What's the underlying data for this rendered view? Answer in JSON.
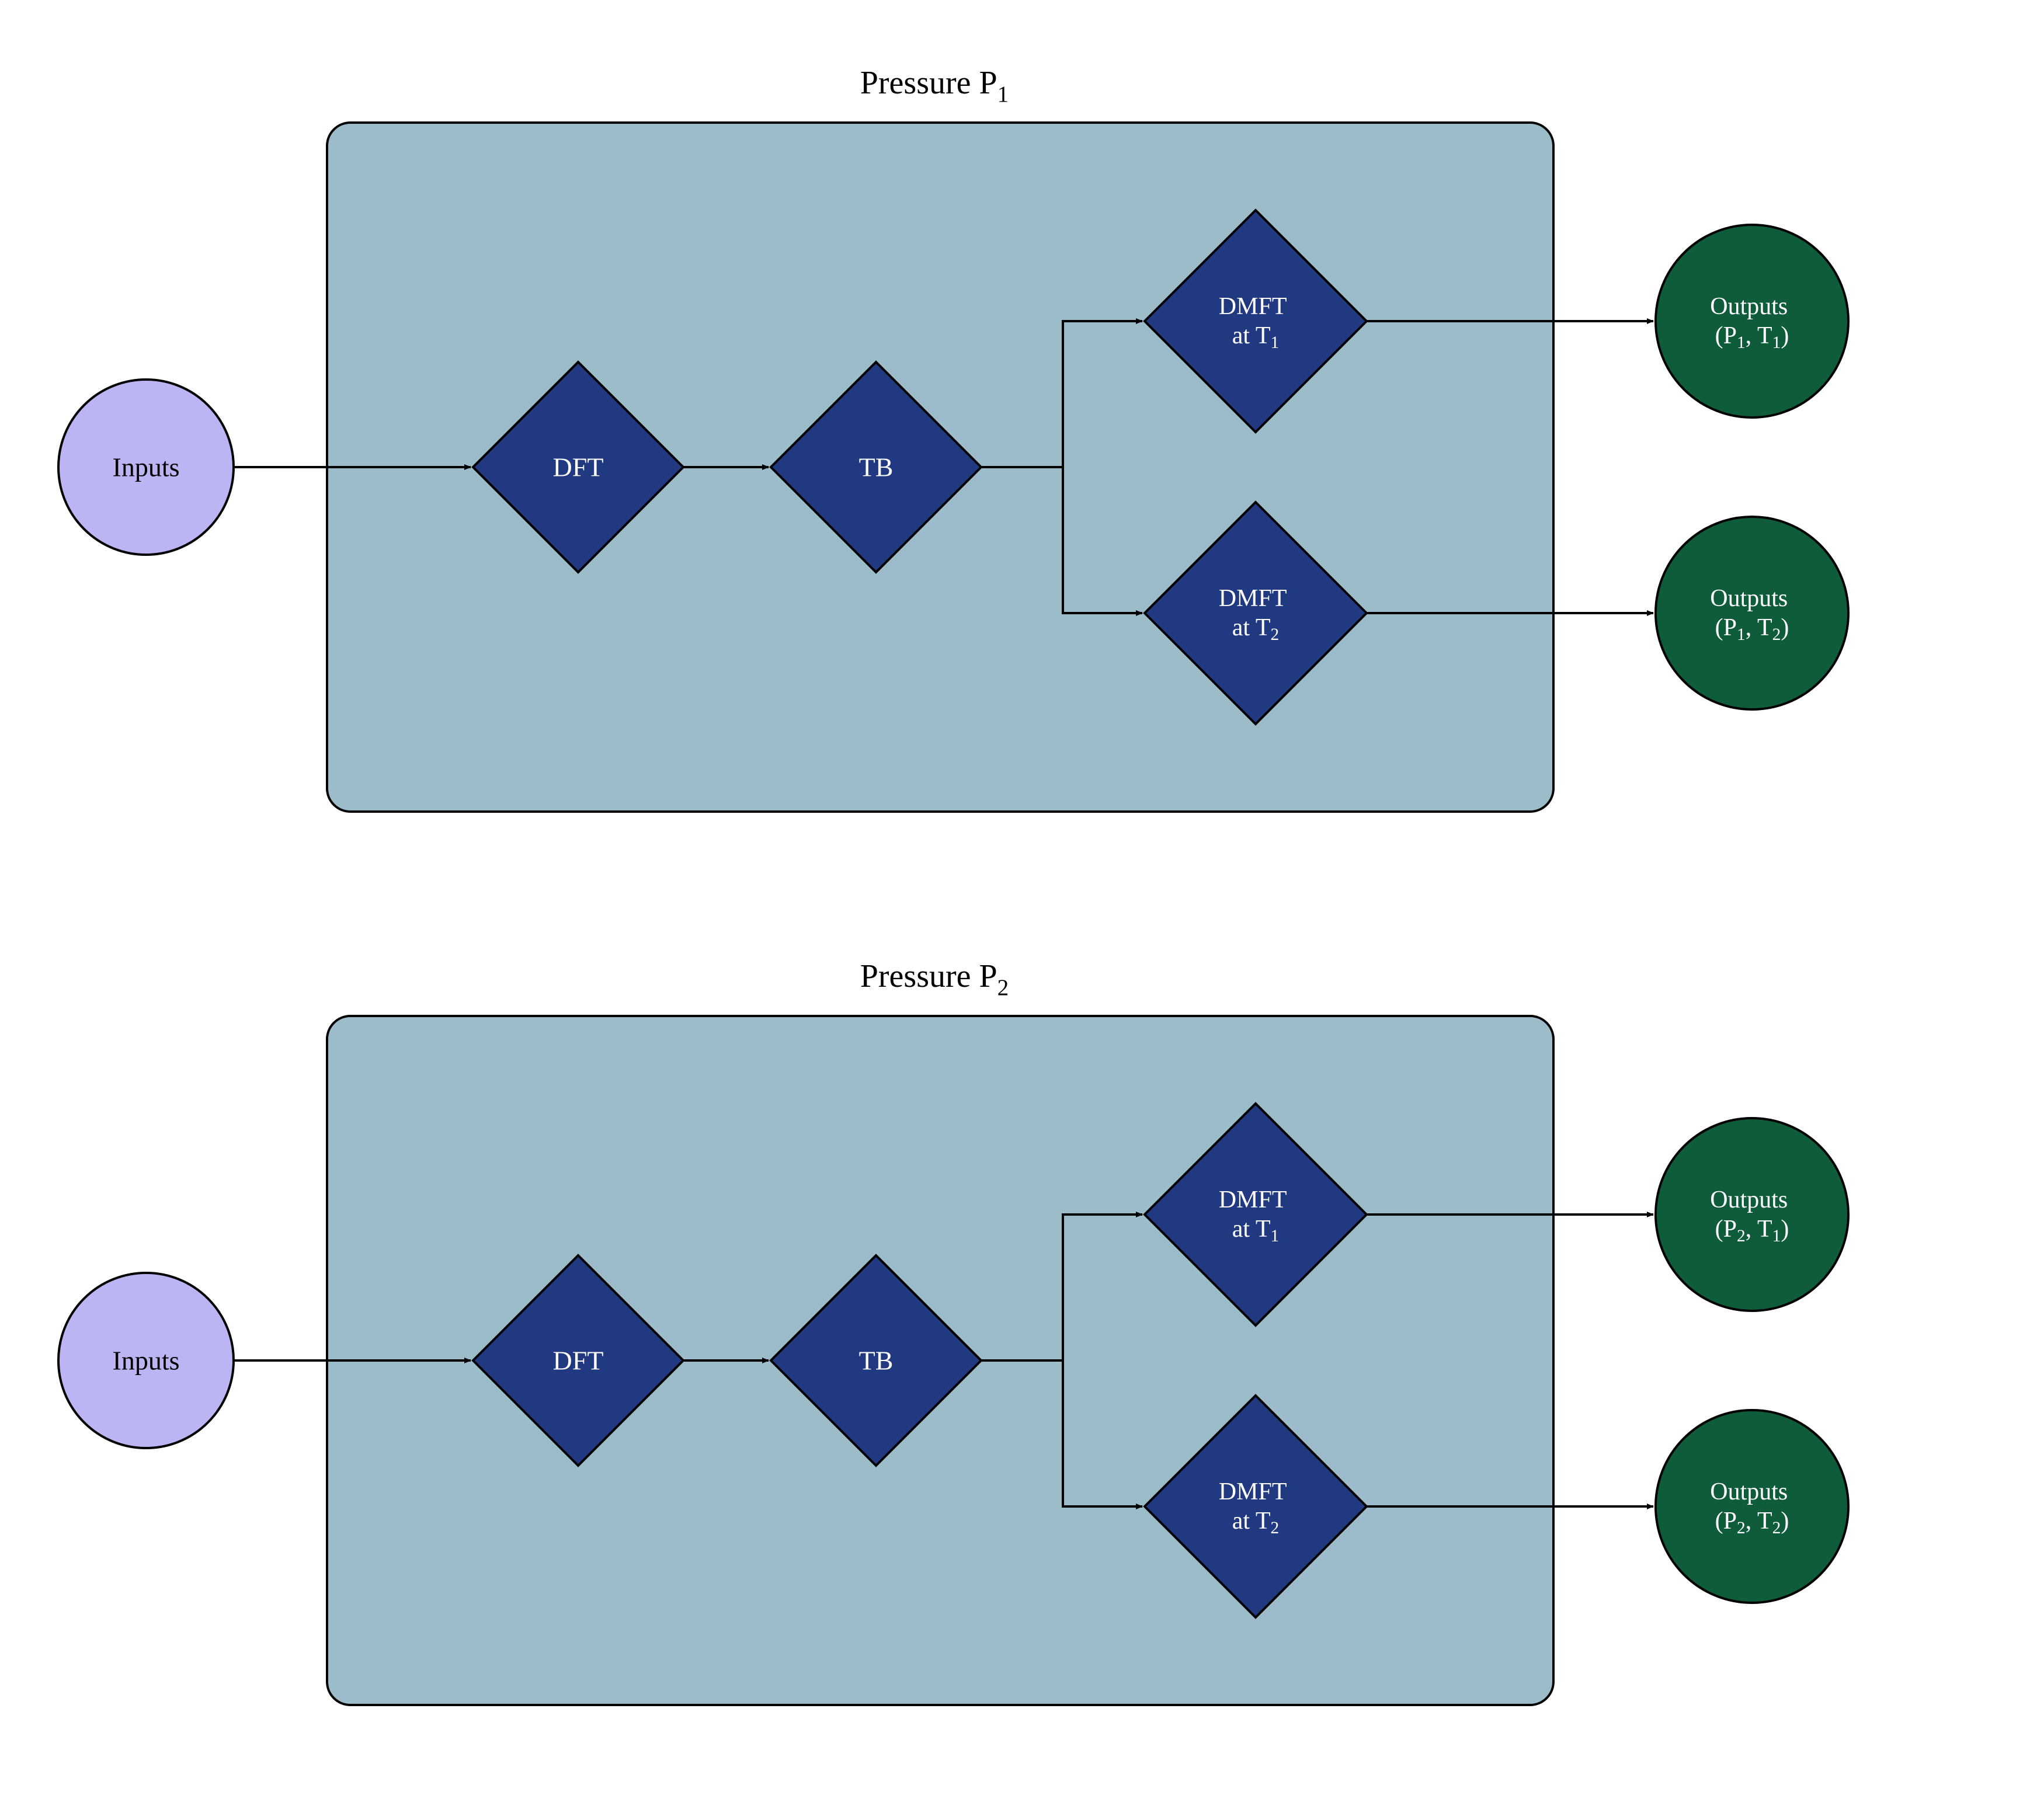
{
  "panels": [
    {
      "title_prefix": "Pressure P",
      "title_sub": "1",
      "input_label": "Inputs",
      "dft_label": "DFT",
      "tb_label": "TB",
      "dmft1_line1": "DMFT",
      "dmft1_line2_prefix": "at T",
      "dmft1_line2_sub": "1",
      "dmft2_line1": "DMFT",
      "dmft2_line2_prefix": "at T",
      "dmft2_line2_sub": "2",
      "out1_line1": "Outputs",
      "out1_line2_open": "(P",
      "out1_line2_p_sub": "1",
      "out1_line2_mid": ", T",
      "out1_line2_t_sub": "1",
      "out1_line2_close": ")",
      "out2_line1": "Outputs",
      "out2_line2_open": "(P",
      "out2_line2_p_sub": "1",
      "out2_line2_mid": ", T",
      "out2_line2_t_sub": "2",
      "out2_line2_close": ")"
    },
    {
      "title_prefix": "Pressure P",
      "title_sub": "2",
      "input_label": "Inputs",
      "dft_label": "DFT",
      "tb_label": "TB",
      "dmft1_line1": "DMFT",
      "dmft1_line2_prefix": "at T",
      "dmft1_line2_sub": "1",
      "dmft2_line1": "DMFT",
      "dmft2_line2_prefix": "at T",
      "dmft2_line2_sub": "2",
      "out1_line1": "Outputs",
      "out1_line2_open": "(P",
      "out1_line2_p_sub": "2",
      "out1_line2_mid": ", T",
      "out1_line2_t_sub": "1",
      "out1_line2_close": ")",
      "out2_line1": "Outputs",
      "out2_line2_open": "(P",
      "out2_line2_p_sub": "2",
      "out2_line2_mid": ", T",
      "out2_line2_t_sub": "2",
      "out2_line2_close": ")"
    }
  ]
}
